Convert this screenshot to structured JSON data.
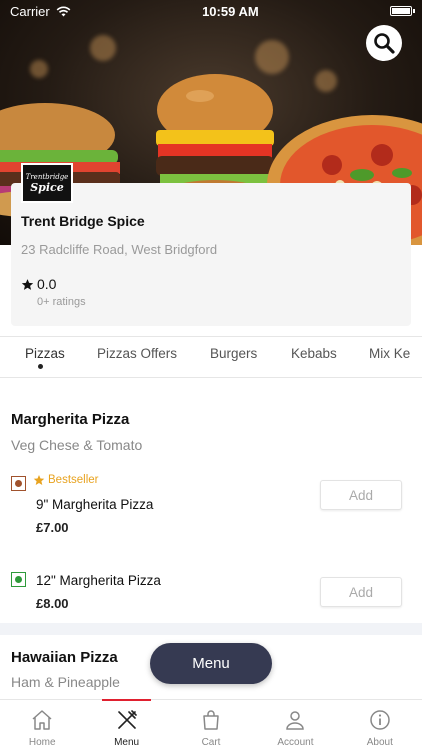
{
  "status_bar": {
    "carrier": "Carrier",
    "time": "10:59 AM"
  },
  "restaurant": {
    "logo_line1": "Trentbridge",
    "logo_line2": "Spice",
    "name": "Trent Bridge Spice",
    "address": "23 Radcliffe Road, West Bridgford",
    "rating": "0.0",
    "ratings_count": "0+ ratings"
  },
  "categories": [
    "Pizzas",
    "Pizzas Offers",
    "Burgers",
    "Kebabs",
    "Mix Ke"
  ],
  "menu_sections": [
    {
      "title": "Margherita Pizza",
      "description": "Veg Chese & Tomato",
      "items": [
        {
          "badge": "Bestseller",
          "name": "9\" Margherita Pizza",
          "price": "£7.00",
          "add_label": "Add",
          "type": "non-veg"
        },
        {
          "name": "12\" Margherita Pizza",
          "price": "£8.00",
          "add_label": "Add",
          "type": "veg"
        }
      ]
    },
    {
      "title": "Hawaiian Pizza",
      "description": "Ham & Pineapple"
    }
  ],
  "menu_button_label": "Menu",
  "bottom_nav": [
    {
      "label": "Home",
      "icon": "home-icon"
    },
    {
      "label": "Menu",
      "icon": "fork-knife-icon"
    },
    {
      "label": "Cart",
      "icon": "bag-icon"
    },
    {
      "label": "Account",
      "icon": "person-icon"
    },
    {
      "label": "About",
      "icon": "info-icon"
    }
  ],
  "colors": {
    "accent_red": "#e0202f",
    "bestseller": "#e8a320",
    "veg_green": "#2e9a3a",
    "nonveg_brown": "#a0522d",
    "menu_button": "#363a52"
  }
}
